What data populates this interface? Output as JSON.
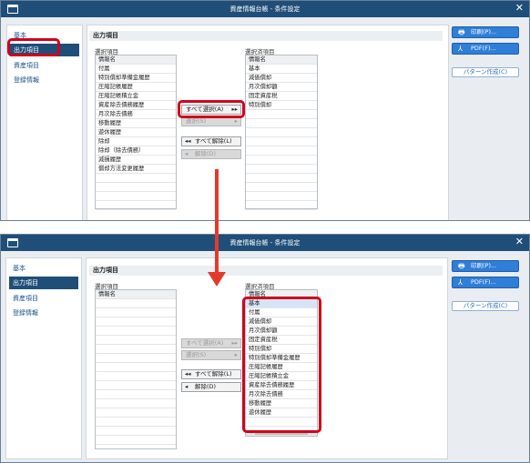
{
  "window": {
    "title": "資産情報台帳 - 条件設定",
    "close_glyph": "✕"
  },
  "sidebar": {
    "items": [
      {
        "label": "基本"
      },
      {
        "label": "出力項目"
      },
      {
        "label": "資産項目"
      },
      {
        "label": "登録情報"
      }
    ],
    "active_index": 1
  },
  "section": {
    "title": "出力項目",
    "available_label": "選択項目",
    "selected_label": "選択済項目"
  },
  "screen1": {
    "available_header": "情報名",
    "available_items": [
      "付属",
      "特別償却準備金履歴",
      "圧縮記帳履歴",
      "圧縮記帳積立金",
      "資産除去債務履歴",
      "月次除去債務",
      "移動履歴",
      "遊休履歴",
      "除却",
      "除却（除去債務）",
      "減損履歴",
      "償却方法変更履歴"
    ],
    "selected_header": "情報名",
    "selected_items": [
      "基本",
      "減価償却",
      "月次償却額",
      "固定資産税",
      "特別償却"
    ]
  },
  "screen2": {
    "available_header": "情報名",
    "selected_header": "情報名",
    "selected_items": [
      "基本",
      "付属",
      "減価償却",
      "月次償却額",
      "固定資産税",
      "特別償却",
      "特別償却準備金履歴",
      "圧縮記帳履歴",
      "圧縮記帳積立金",
      "資産除去債務履歴",
      "月次除去債務",
      "移動履歴",
      "遊休履歴"
    ]
  },
  "buttons": {
    "select_all": "すべて選択(A)",
    "select": "選択(S)",
    "deselect_all": "すべて解除(L)",
    "deselect": "解除(D)",
    "arrow_double_right": "▸▸",
    "arrow_right": "▸",
    "arrow_double_left": "◂◂",
    "arrow_left": "◂",
    "print": "印刷(P)...",
    "pdf": "PDF(F)...",
    "pattern": "パターン作成(C)"
  },
  "colors": {
    "titlebar": "#1f4e79",
    "active_item": "#1f4e79",
    "highlight": "#d0021b",
    "arrow": "#e23b2e",
    "primary_button": "#2f7ed8"
  },
  "icons": {
    "app": "window-icon",
    "print": "printer-icon",
    "pdf": "pdf-icon"
  }
}
